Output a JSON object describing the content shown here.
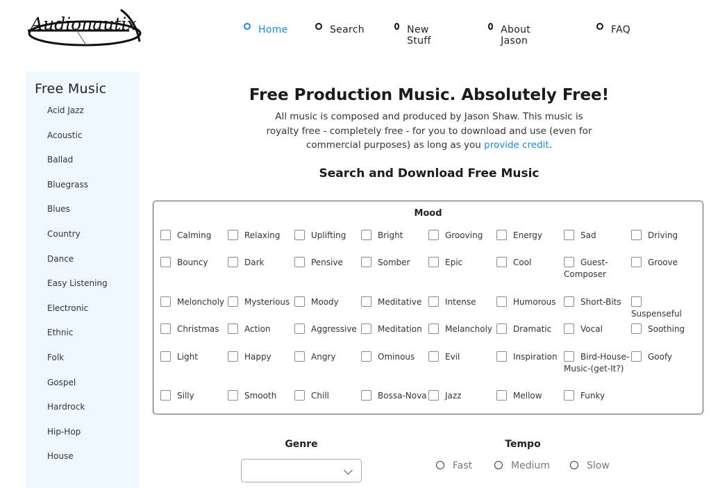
{
  "brand": {
    "logo_text": "Audionautix"
  },
  "nav": {
    "items": [
      {
        "label": "Home",
        "active": true
      },
      {
        "label": "Search",
        "active": false
      },
      {
        "label": "New Stuff",
        "active": false
      },
      {
        "label": "About Jason",
        "active": false
      },
      {
        "label": "FAQ",
        "active": false
      }
    ]
  },
  "sidebar": {
    "title": "Free Music",
    "items": [
      "Acid Jazz",
      "Acoustic",
      "Ballad",
      "Bluegrass",
      "Blues",
      "Country",
      "Dance",
      "Easy Listening",
      "Electronic",
      "Ethnic",
      "Folk",
      "Gospel",
      "Hardrock",
      "Hip-Hop",
      "House"
    ]
  },
  "main": {
    "title": "Free Production Music. Absolutely Free!",
    "intro_text": "All music is composed and produced by Jason Shaw. This music is royalty free - completely free - for you to download and use (even for commercial purposes) as long as you ",
    "intro_link": "provide credit",
    "intro_end": ".",
    "search_heading": "Search and Download Free Music"
  },
  "mood": {
    "title": "Mood",
    "rows": [
      [
        "Calming",
        "Relaxing",
        "Uplifting",
        "Bright",
        "Grooving",
        "Energy",
        "Sad",
        "Driving"
      ],
      [
        "Bouncy",
        "Dark",
        "Pensive",
        "Somber",
        "Epic",
        "Cool",
        "Guest-Composer",
        "Groove"
      ],
      [
        "Meloncholy",
        "Mysterious",
        "Moody",
        "Meditative",
        "Intense",
        "Humorous",
        "Short-Bits",
        "Suspenseful"
      ],
      [
        "Christmas",
        "Action",
        "Aggressive",
        "Meditation",
        "Melancholy",
        "Dramatic",
        "Vocal",
        "Soothing"
      ],
      [
        "Light",
        "Happy",
        "Angry",
        "Ominous",
        "Evil",
        "Inspiration",
        "Bird-House-Music-(get-It?)",
        "Goofy"
      ],
      [
        "Silly",
        "Smooth",
        "Chill",
        "Bossa-Nova",
        "Jazz",
        "Mellow",
        "Funky"
      ]
    ]
  },
  "genre": {
    "label": "Genre",
    "selected": ""
  },
  "tempo": {
    "label": "Tempo",
    "options": [
      "Fast",
      "Medium",
      "Slow"
    ]
  },
  "colors": {
    "accent": "#1e88d8",
    "sidebar_bg": "#eef6fe"
  }
}
